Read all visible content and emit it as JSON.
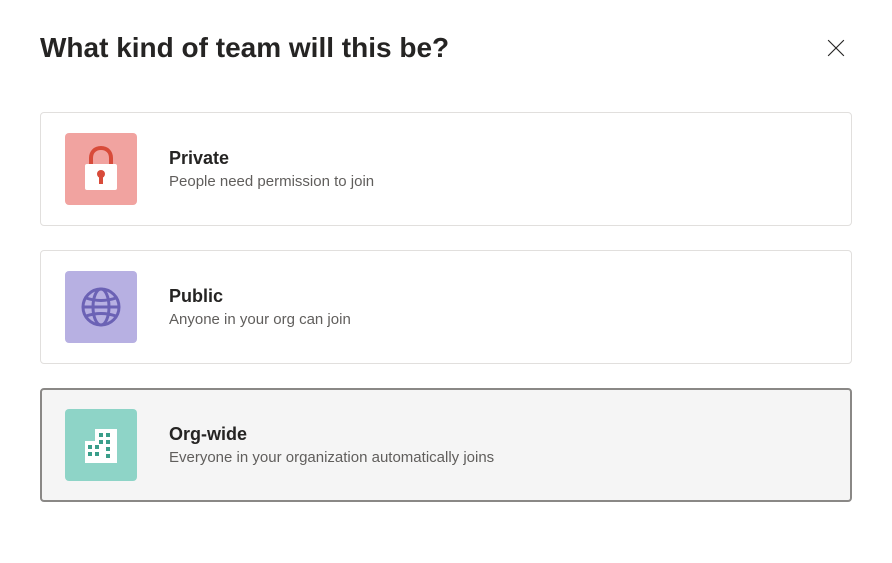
{
  "dialog": {
    "title": "What kind of team will this be?"
  },
  "options": {
    "private": {
      "title": "Private",
      "description": "People need permission to join"
    },
    "public": {
      "title": "Public",
      "description": "Anyone in your org can join"
    },
    "orgwide": {
      "title": "Org-wide",
      "description": "Everyone in your organization automatically joins"
    }
  },
  "colors": {
    "private_bg": "#f1a3a0",
    "public_bg": "#b7b0e2",
    "orgwide_bg": "#8ed4c7"
  }
}
